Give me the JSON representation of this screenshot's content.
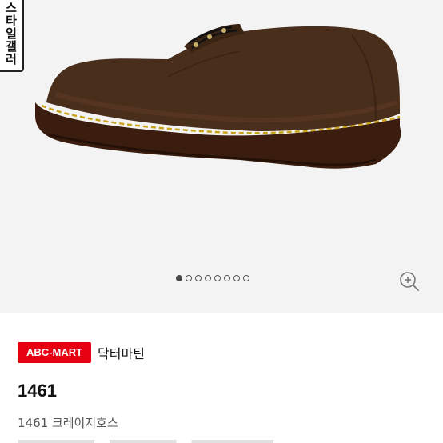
{
  "gallery": {
    "style_gallery_label": "스타일갤러",
    "total_images": 8,
    "active_index": 0
  },
  "product": {
    "store_badge": "ABC-MART",
    "brand": "닥터마틴",
    "title": "1461",
    "subtitle": "1461 크레이지호스"
  },
  "icons": {
    "zoom": "zoom-in-icon"
  },
  "colors": {
    "store_badge_bg": "#e60012",
    "image_bg": "#f3f3f3"
  }
}
